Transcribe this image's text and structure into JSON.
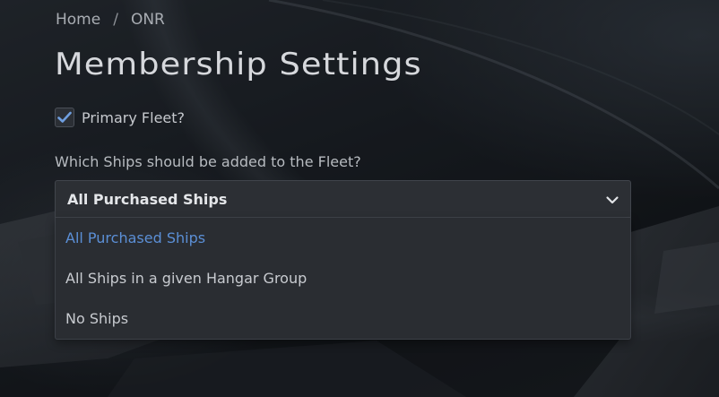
{
  "breadcrumb": {
    "home": "Home",
    "separator": "/",
    "current": "ONR"
  },
  "page_title": "Membership Settings",
  "primary_fleet": {
    "label": "Primary Fleet?",
    "checked": true
  },
  "ships_question": "Which Ships should be added to the Fleet?",
  "ships_select": {
    "selected": "All Purchased Ships",
    "options": [
      "All Purchased Ships",
      "All Ships in a given Hangar Group",
      "No Ships"
    ]
  },
  "icons": {
    "checkbox": "checkmark-icon",
    "select": "chevron-down-icon"
  },
  "colors": {
    "accent": "#5b8fd6",
    "checkmark": "#6f9fe0"
  }
}
